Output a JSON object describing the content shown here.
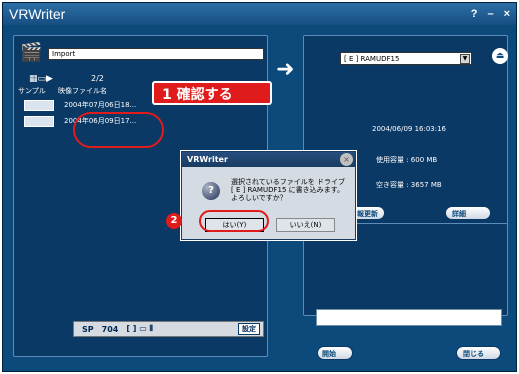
{
  "window": {
    "title": "VRWriter",
    "controls": [
      "?",
      "–",
      "×"
    ]
  },
  "left": {
    "import_label": "Import",
    "count": "2/2",
    "columns": [
      "サンプル",
      "映像ファイル名"
    ],
    "rows": [
      {
        "name": "2004年07月06日18..."
      },
      {
        "name": "2004年06月09日17..."
      }
    ],
    "bottom_bar": {
      "sp": "SP",
      "value": "704",
      "setting": "設定"
    }
  },
  "right": {
    "drive": "[ E ] RAMUDF15",
    "date": "2004/06/09 16:03:16",
    "used": "使用容量 : 600 MB",
    "free": "空き容量 : 3657 MB",
    "refresh_btn": "情報更新",
    "detail_btn": "詳細",
    "burn_btn": "開始",
    "close_btn": "閉じる"
  },
  "dialog": {
    "title": "VRWriter",
    "message": "選択されているファイルを ドライブ[ E ] RAMUDF15 に書き込みます。よろしいですか？",
    "yes": "はい(Y)",
    "no": "いいえ(N)"
  },
  "annotations": {
    "callout_number": "1",
    "callout_text": "確認する",
    "badge_two": "2"
  },
  "colors": {
    "window_bg": "#0c4a7c",
    "accent_red": "#e01b1b"
  }
}
